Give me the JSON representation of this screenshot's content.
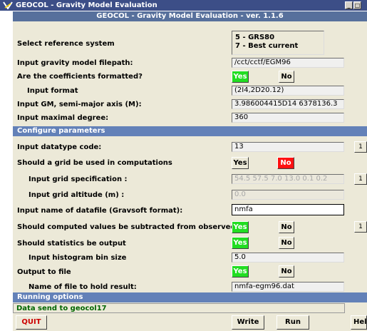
{
  "window": {
    "title": "GEOCOL - Gravity Model Evaluation",
    "minimize_glyph": "_",
    "maximize_glyph": "□",
    "subtitle": "GEOCOL - Gravity Model Evaluation - ver. 1.1.6"
  },
  "model": {
    "reference_label": "Select reference system",
    "reference_line1": "5 - GRS80",
    "reference_line2": "7 - Best current",
    "filepath_label": "Input gravity model filepath:",
    "filepath_value": "/cct/cctf/EGM96",
    "formatted_label": "Are the coefficients formatted?",
    "formatted_yes": "Yes",
    "formatted_no": "No",
    "format_label": "Input format",
    "format_value": "(2I4,2D20.12)",
    "gm_label": "Input GM, semi-major axis (M):",
    "gm_value": "3.986004415D14 6378136.3",
    "degree_label": "Input maximal degree:",
    "degree_value": "360"
  },
  "configure": {
    "section_title": "Configure parameters",
    "datatype_label": "Input datatype code:",
    "datatype_value": "13",
    "grid_label": "Should a grid be used in computations",
    "grid_yes": "Yes",
    "grid_no": "No",
    "grid_spec_label": "Input grid specification :",
    "grid_spec_value": "54.5 57.5 7.0 13.0 0.1 0.2",
    "grid_alt_label": "Input grid altitude (m) :",
    "grid_alt_value": "0.0",
    "datafile_label": "Input name of datafile (Gravsoft format):",
    "datafile_value": "nmfa",
    "subtract_label": "Should computed values be subtracted from observed",
    "subtract_yes": "Yes",
    "subtract_no": "No",
    "stats_label": "Should statistics be output",
    "stats_yes": "Yes",
    "stats_no": "No",
    "histogram_label": "Input histogram bin size",
    "histogram_value": "5.0",
    "output_label": "Output to file",
    "output_yes": "Yes",
    "output_no": "No",
    "result_file_label": "Name of file to hold result:",
    "result_file_value": "nmfa-egm96.dat",
    "side_button_glyph": "1"
  },
  "running": {
    "section_title": "Running options",
    "message": "Data send to geocol17",
    "quit": "QUIT",
    "write": "Write",
    "run": "Run",
    "help": "Help"
  },
  "colors": {
    "title_bar": "#3c4e87",
    "section": "#6381b8",
    "yes_active": "#22dd22",
    "no_active": "#ff1111",
    "quit_text": "#cc0000"
  }
}
